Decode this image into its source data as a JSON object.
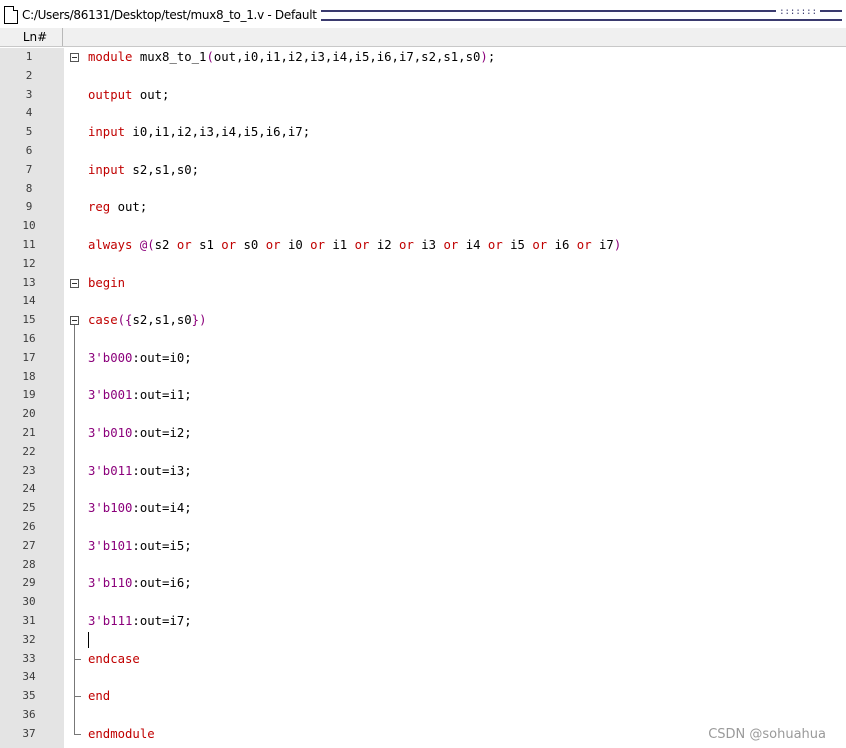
{
  "window": {
    "title": "C:/Users/86131/Desktop/test/mux8_to_1.v - Default",
    "grip": ":::::::"
  },
  "header": {
    "ln_label": "Ln#"
  },
  "lines": [
    {
      "n": "1",
      "tokens": [
        [
          "kw",
          "module"
        ],
        [
          "pl",
          " mux8_to_1"
        ],
        [
          "op",
          "("
        ],
        [
          "pl",
          "out,i0,i1,i2,i3,i4,i5,i6,i7,s2,s1,s0"
        ],
        [
          "op",
          ")"
        ],
        [
          "pl",
          ";"
        ]
      ]
    },
    {
      "n": "2",
      "tokens": []
    },
    {
      "n": "3",
      "tokens": [
        [
          "kw",
          "output"
        ],
        [
          "pl",
          " out;"
        ]
      ]
    },
    {
      "n": "4",
      "tokens": []
    },
    {
      "n": "5",
      "tokens": [
        [
          "kw",
          "input"
        ],
        [
          "pl",
          " i0,i1,i2,i3,i4,i5,i6,i7;"
        ]
      ]
    },
    {
      "n": "6",
      "tokens": []
    },
    {
      "n": "7",
      "tokens": [
        [
          "kw",
          "input"
        ],
        [
          "pl",
          " s2,s1,s0;"
        ]
      ]
    },
    {
      "n": "8",
      "tokens": []
    },
    {
      "n": "9",
      "tokens": [
        [
          "kw",
          "reg"
        ],
        [
          "pl",
          " out;"
        ]
      ]
    },
    {
      "n": "10",
      "tokens": []
    },
    {
      "n": "11",
      "tokens": [
        [
          "kw",
          "always"
        ],
        [
          "pl",
          " "
        ],
        [
          "op",
          "@("
        ],
        [
          "pl",
          "s2 "
        ],
        [
          "kw",
          "or"
        ],
        [
          "pl",
          " s1 "
        ],
        [
          "kw",
          "or"
        ],
        [
          "pl",
          " s0 "
        ],
        [
          "kw",
          "or"
        ],
        [
          "pl",
          " i0 "
        ],
        [
          "kw",
          "or"
        ],
        [
          "pl",
          " i1 "
        ],
        [
          "kw",
          "or"
        ],
        [
          "pl",
          " i2 "
        ],
        [
          "kw",
          "or"
        ],
        [
          "pl",
          " i3 "
        ],
        [
          "kw",
          "or"
        ],
        [
          "pl",
          " i4 "
        ],
        [
          "kw",
          "or"
        ],
        [
          "pl",
          " i5 "
        ],
        [
          "kw",
          "or"
        ],
        [
          "pl",
          " i6 "
        ],
        [
          "kw",
          "or"
        ],
        [
          "pl",
          " i7"
        ],
        [
          "op",
          ")"
        ]
      ]
    },
    {
      "n": "12",
      "tokens": []
    },
    {
      "n": "13",
      "tokens": [
        [
          "kw",
          "begin"
        ]
      ]
    },
    {
      "n": "14",
      "tokens": []
    },
    {
      "n": "15",
      "tokens": [
        [
          "kw",
          "case"
        ],
        [
          "op",
          "({"
        ],
        [
          "pl",
          "s2,s1,s0"
        ],
        [
          "op",
          "})"
        ]
      ]
    },
    {
      "n": "16",
      "tokens": []
    },
    {
      "n": "17",
      "tokens": [
        [
          "num",
          "3'b000"
        ],
        [
          "pl",
          ":out=i0;"
        ]
      ]
    },
    {
      "n": "18",
      "tokens": []
    },
    {
      "n": "19",
      "tokens": [
        [
          "num",
          "3'b001"
        ],
        [
          "pl",
          ":out=i1;"
        ]
      ]
    },
    {
      "n": "20",
      "tokens": []
    },
    {
      "n": "21",
      "tokens": [
        [
          "num",
          "3'b010"
        ],
        [
          "pl",
          ":out=i2;"
        ]
      ]
    },
    {
      "n": "22",
      "tokens": []
    },
    {
      "n": "23",
      "tokens": [
        [
          "num",
          "3'b011"
        ],
        [
          "pl",
          ":out=i3;"
        ]
      ]
    },
    {
      "n": "24",
      "tokens": []
    },
    {
      "n": "25",
      "tokens": [
        [
          "num",
          "3'b100"
        ],
        [
          "pl",
          ":out=i4;"
        ]
      ]
    },
    {
      "n": "26",
      "tokens": []
    },
    {
      "n": "27",
      "tokens": [
        [
          "num",
          "3'b101"
        ],
        [
          "pl",
          ":out=i5;"
        ]
      ]
    },
    {
      "n": "28",
      "tokens": []
    },
    {
      "n": "29",
      "tokens": [
        [
          "num",
          "3'b110"
        ],
        [
          "pl",
          ":out=i6;"
        ]
      ]
    },
    {
      "n": "30",
      "tokens": []
    },
    {
      "n": "31",
      "tokens": [
        [
          "num",
          "3'b111"
        ],
        [
          "pl",
          ":out=i7;"
        ]
      ]
    },
    {
      "n": "32",
      "tokens": []
    },
    {
      "n": "33",
      "tokens": [
        [
          "kw",
          "endcase"
        ]
      ]
    },
    {
      "n": "34",
      "tokens": []
    },
    {
      "n": "35",
      "tokens": [
        [
          "kw",
          "end"
        ]
      ]
    },
    {
      "n": "36",
      "tokens": []
    },
    {
      "n": "37",
      "tokens": [
        [
          "kw",
          "endmodule"
        ]
      ]
    }
  ],
  "folds": [
    {
      "type": "box",
      "line": "1"
    },
    {
      "type": "box",
      "line": "13"
    },
    {
      "type": "box",
      "line": "15"
    }
  ],
  "watermark": "CSDN @sohuahua",
  "colors": {
    "keyword": "#c00000",
    "number": "#8b007b",
    "gutter": "#e4e4e4"
  }
}
